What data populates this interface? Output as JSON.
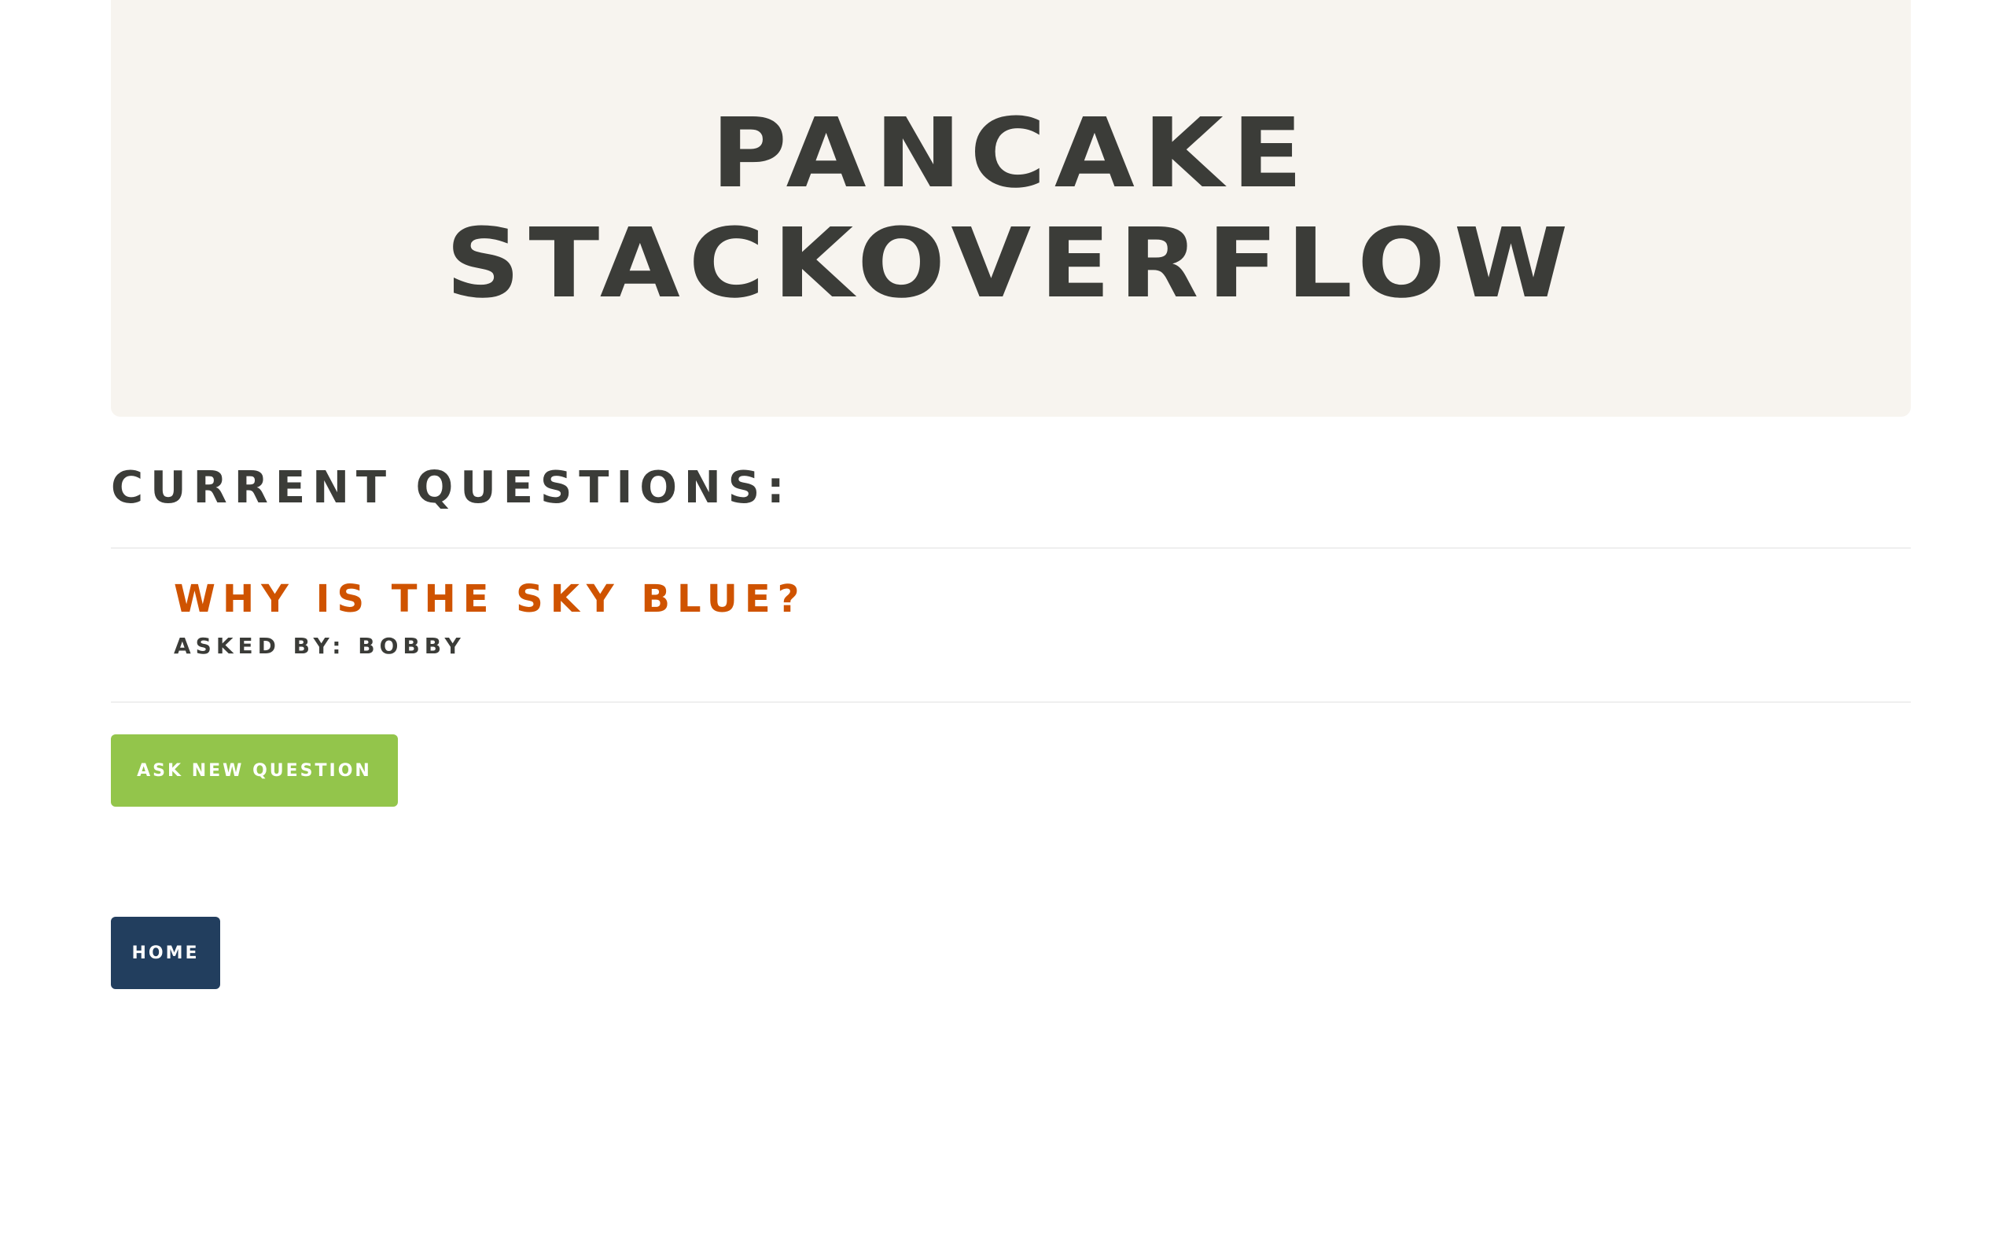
{
  "header": {
    "title_line1": "PANCAKE",
    "title_line2": "STACKOVERFLOW"
  },
  "questions_section": {
    "heading": "CURRENT QUESTIONS:",
    "items": [
      {
        "title": "WHY IS THE SKY BLUE?",
        "asked_by": "ASKED BY: BOBBY"
      }
    ]
  },
  "actions": {
    "ask_label": "ASK NEW QUESTION",
    "home_label": "HOME"
  },
  "colors": {
    "jumbotron_bg": "#f7f4ef",
    "text_dark": "#3b3c38",
    "link_orange": "#cf5300",
    "ask_button_green": "#93c54b",
    "home_button_navy": "#223e5e"
  }
}
